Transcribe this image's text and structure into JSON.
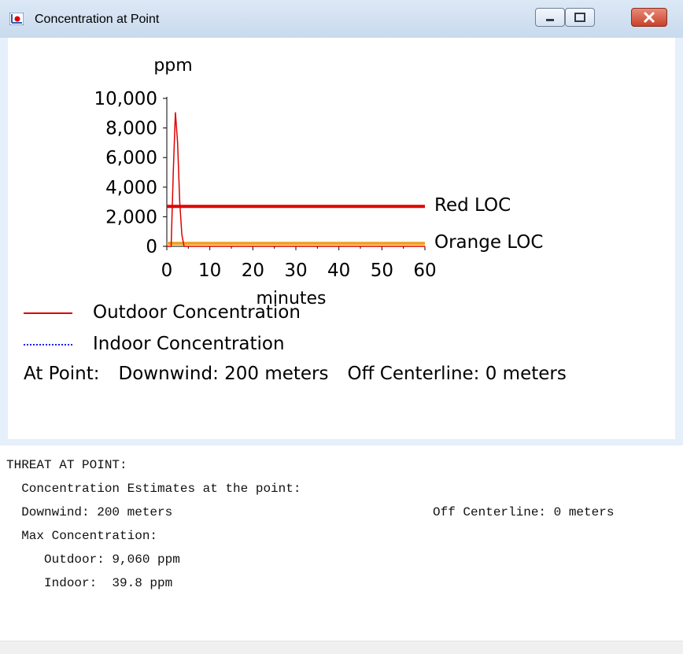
{
  "window": {
    "title": "Concentration at Point",
    "icon": "app-chart-icon",
    "controls": [
      "minimize-icon",
      "maximize-icon",
      "close-icon"
    ]
  },
  "chart_data": {
    "type": "line",
    "ylabel": "ppm",
    "xlabel": "minutes",
    "x_ticks": [
      "0",
      "10",
      "20",
      "30",
      "40",
      "50",
      "60"
    ],
    "y_ticks": [
      "0",
      "2,000",
      "4,000",
      "6,000",
      "8,000",
      "10,000"
    ],
    "xlim": [
      0,
      60
    ],
    "ylim": [
      0,
      10000
    ],
    "series": [
      {
        "name": "Outdoor Concentration",
        "color": "#e00000",
        "x": [
          0,
          1,
          1.5,
          2,
          2.5,
          3,
          3.5,
          4,
          60
        ],
        "y": [
          0,
          0,
          5000,
          9060,
          7000,
          3000,
          800,
          0,
          0
        ]
      }
    ],
    "threshold_lines": [
      {
        "name": "Red LOC",
        "color": "#e00000",
        "y": 2700
      },
      {
        "name": "Orange LOC",
        "color": "#f0a020",
        "y": 200
      }
    ]
  },
  "legend": {
    "outdoor": "Outdoor Concentration",
    "indoor": "Indoor Concentration"
  },
  "point": {
    "prefix": "At Point:",
    "downwind": "Downwind: 200 meters",
    "off_centerline": "Off Centerline: 0 meters"
  },
  "report": {
    "heading": "THREAT AT POINT:",
    "sub": "  Concentration Estimates at the point:",
    "downwind": "  Downwind: 200 meters",
    "off_centerline": "Off Centerline: 0 meters",
    "max_label": "  Max Concentration:",
    "outdoor": "     Outdoor: 9,060 ppm",
    "indoor": "     Indoor:  39.8 ppm"
  }
}
